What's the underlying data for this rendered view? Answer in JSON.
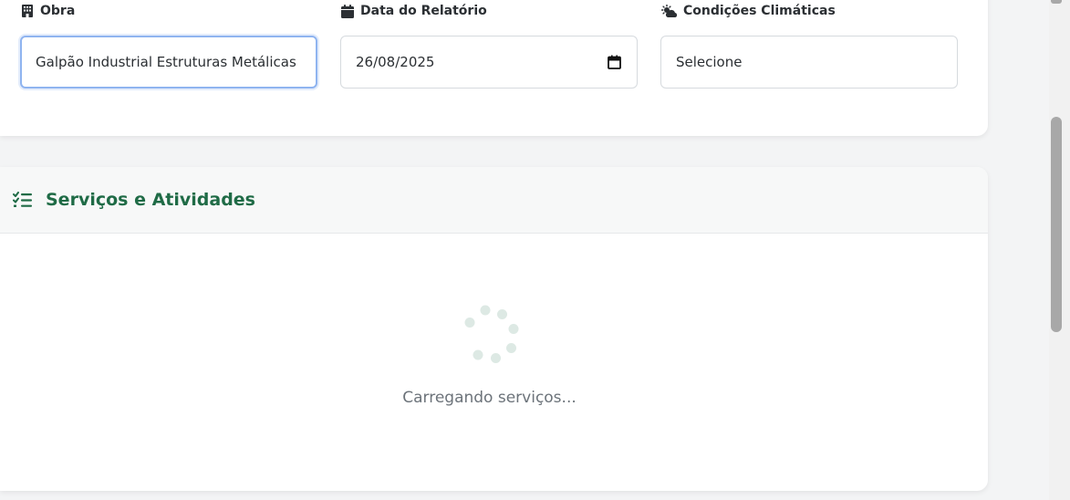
{
  "form": {
    "obra": {
      "label": "Obra",
      "icon": "building-icon",
      "value": "Galpão Industrial Estruturas Metálicas"
    },
    "data_relatorio": {
      "label": "Data do Relatório",
      "icon": "calendar-icon",
      "value": "26/08/2025"
    },
    "condicoes_climaticas": {
      "label": "Condições Climáticas",
      "icon": "cloud-sun-icon",
      "value": "Selecione"
    }
  },
  "services": {
    "title": "Serviços e Atividades",
    "icon": "task-list-icon",
    "loading_text": "Carregando serviços..."
  },
  "colors": {
    "accent": "#1f6b46",
    "focus": "#8fb4f0"
  }
}
